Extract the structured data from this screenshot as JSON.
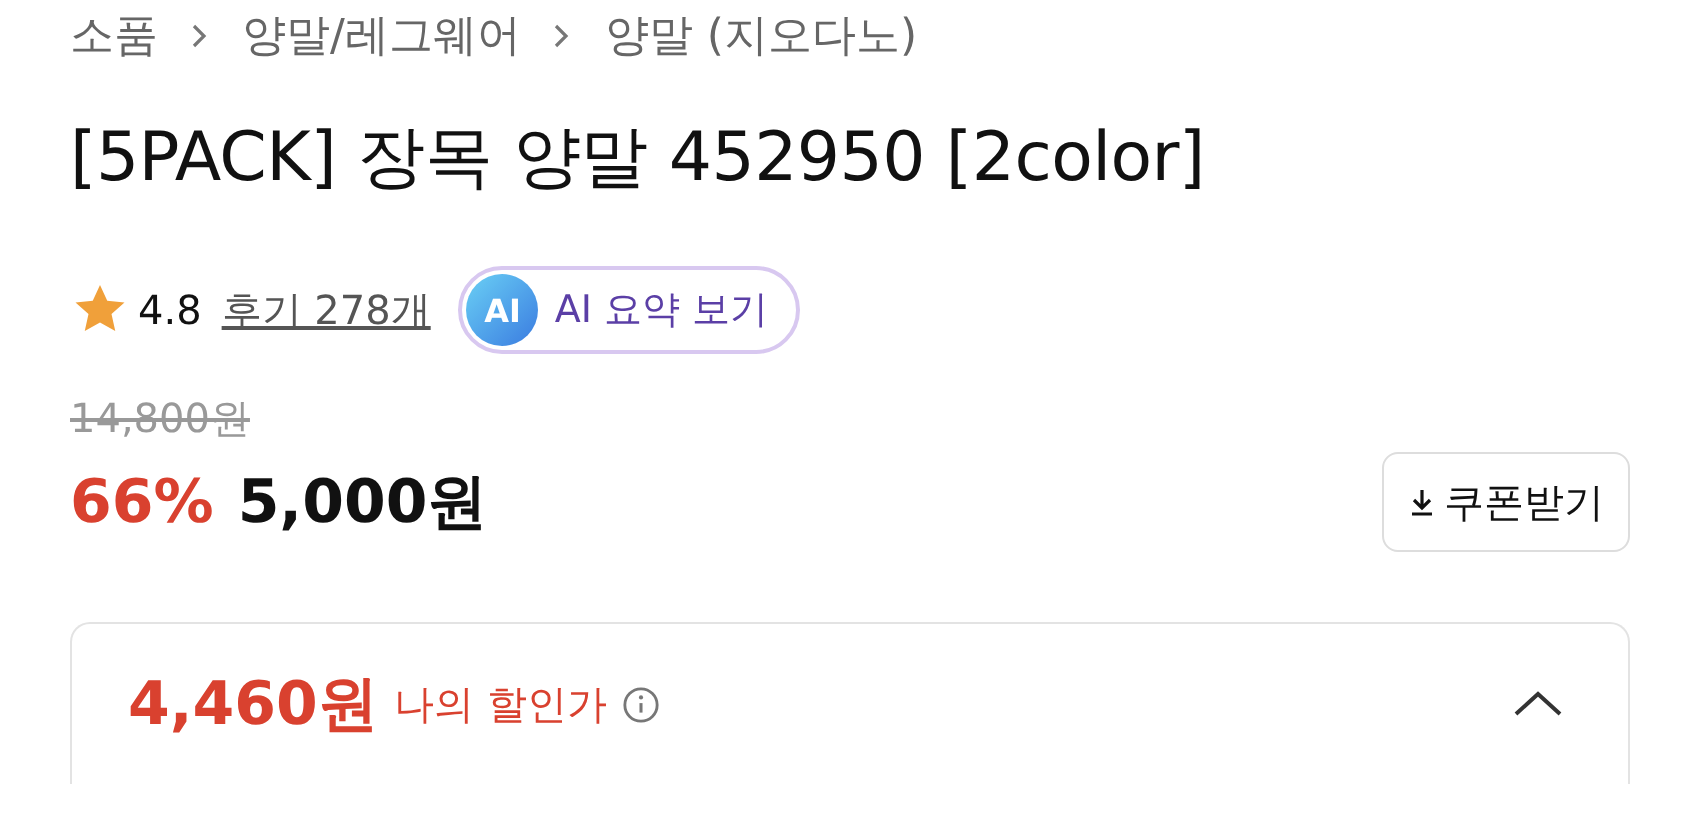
{
  "breadcrumb": [
    "소품",
    "양말/레그웨어",
    "양말 (지오다노)"
  ],
  "title": "[5PACK] 장목 양말 452950 [2color]",
  "rating": {
    "score": "4.8",
    "reviews": "후기 278개",
    "ai_badge": "AI",
    "ai_button": "AI 요약 보기"
  },
  "price": {
    "original": "14,800원",
    "discount": "66%",
    "sale": "5,000원",
    "coupon_button": "쿠폰받기"
  },
  "my_price": {
    "amount": "4,460원",
    "label": "나의 할인가",
    "expanded": true
  }
}
